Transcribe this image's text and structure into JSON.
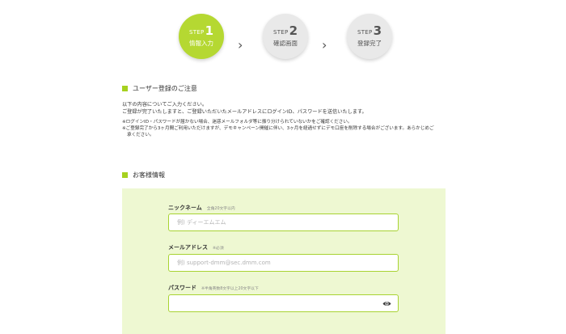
{
  "steps": [
    {
      "word": "STEP",
      "num": "1",
      "name": "情報入力",
      "state": "active"
    },
    {
      "word": "STEP",
      "num": "2",
      "name": "確認画面",
      "state": "inactive"
    },
    {
      "word": "STEP",
      "num": "3",
      "name": "登録完了",
      "state": "inactive"
    }
  ],
  "step_separator": "›",
  "notice": {
    "title": "ユーザー登録のご注意",
    "lines": [
      "以下の内容についてご入力ください。",
      "ご登録が完了いたしますと、ご登録いただいたメールアドレスにログインID、パスワードを送信いたします。"
    ],
    "notes": [
      "※ログインID・パスワードが届かない場合、迷惑メールフォルダ等に振り分けられていないかをご確認ください。",
      "※ご登録完了から3ヶ月間ご利用いただけますが、デモキャンペーン開催に伴い、3ヶ月を経過せずにデモ口座を削除する場合がございます。あらかじめご",
      "承ください。"
    ]
  },
  "customer": {
    "title": "お客様情報",
    "nickname": {
      "label": "ニックネーム",
      "note": "全角20文字以内",
      "placeholder": "例) ディーエムエム"
    },
    "email": {
      "label": "メールアドレス",
      "note": "※必須",
      "placeholder": "例) support-dmm@sec.dmm.com"
    },
    "password": {
      "label": "パスワード",
      "note": "※半角英数8文字以上20文字以下",
      "placeholder": ""
    }
  },
  "colors": {
    "accent": "#b5d832",
    "panel_bg": "#eef8d2",
    "input_border": "#a8d332",
    "bullet": "#a6d11f"
  },
  "icons": {
    "password_toggle": "eye-icon"
  }
}
